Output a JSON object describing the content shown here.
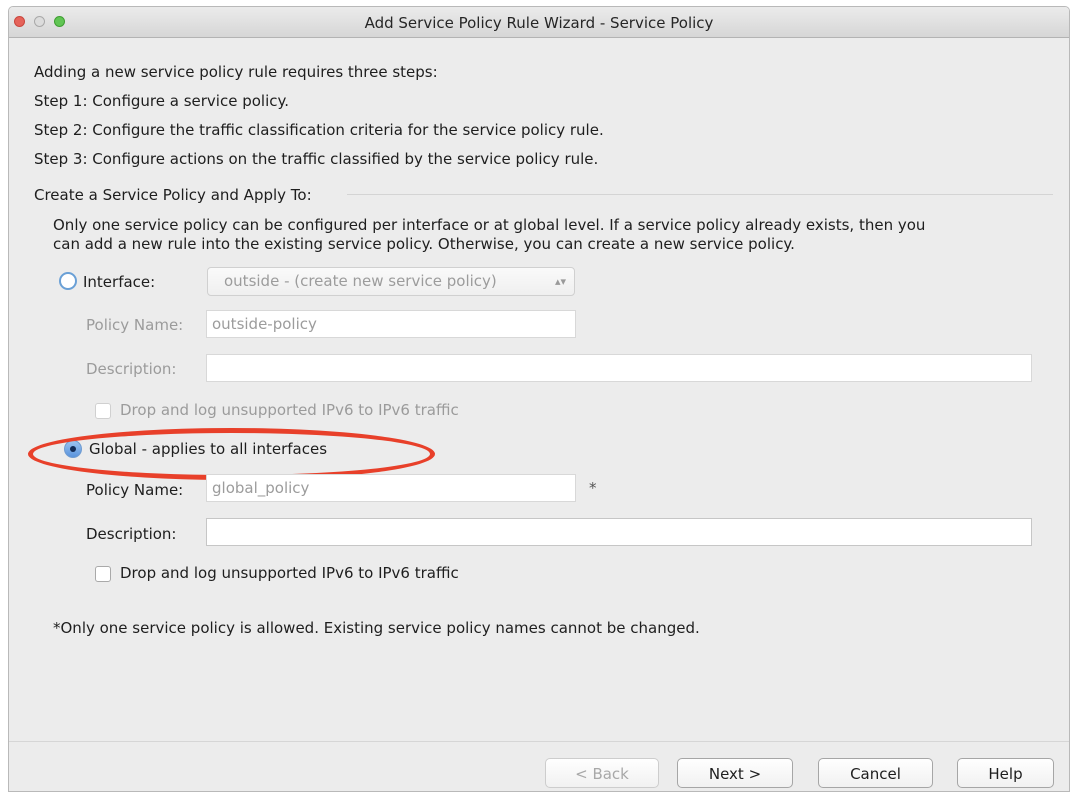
{
  "window": {
    "title": "Add Service Policy Rule Wizard - Service Policy"
  },
  "intro": {
    "heading": "Adding a new service policy rule requires three steps:",
    "step1": "Step 1:  Configure a service policy.",
    "step2": "Step 2:  Configure the traffic classification criteria for the service policy rule.",
    "step3": "Step 3:  Configure actions on the traffic classified by the service policy rule."
  },
  "section": {
    "title": "Create a Service Policy and Apply To:",
    "note_line1": "Only one service policy can be configured per interface or at global level. If a service policy already exists, then you",
    "note_line2": "can add a new rule into the existing service policy. Otherwise, you can create a new service policy."
  },
  "interface_option": {
    "label": "Interface:",
    "selected": false,
    "select_value": "outside - (create new service policy)",
    "policy_name_label": "Policy Name:",
    "policy_name_value": "outside-policy",
    "description_label": "Description:",
    "description_value": "",
    "drop_ipv6_label": "Drop and log unsupported IPv6 to IPv6 traffic",
    "drop_ipv6_checked": false
  },
  "global_option": {
    "label": "Global - applies to all interfaces",
    "selected": true,
    "policy_name_label": "Policy Name:",
    "policy_name_value": "global_policy",
    "required_mark": "*",
    "description_label": "Description:",
    "description_value": "",
    "drop_ipv6_label": "Drop and log unsupported IPv6 to IPv6 traffic",
    "drop_ipv6_checked": false
  },
  "footnote": "*Only one service policy is allowed. Existing service policy names cannot be changed.",
  "buttons": {
    "back": "< Back",
    "next": "Next >",
    "cancel": "Cancel",
    "help": "Help"
  },
  "colors": {
    "highlight_ellipse": "#e8402a",
    "radio_selected": "#5a93dd"
  }
}
